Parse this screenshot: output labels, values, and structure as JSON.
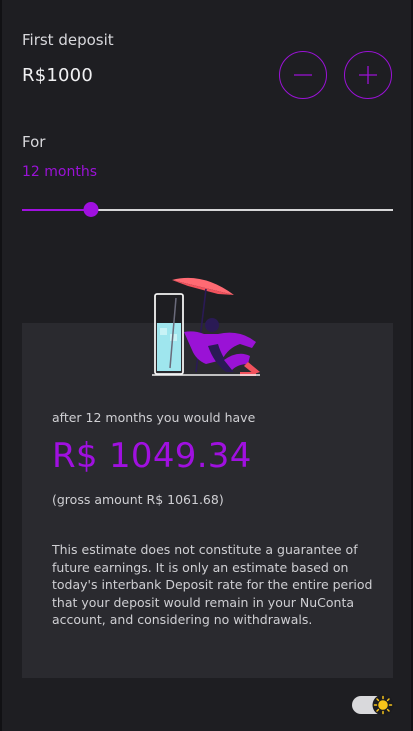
{
  "deposit": {
    "label": "First deposit",
    "amount": "R$1000",
    "decrease_icon": "minus-icon",
    "increase_icon": "plus-icon"
  },
  "period": {
    "label": "For",
    "value": "12 months",
    "slider_fraction": 0.186
  },
  "result": {
    "intro": "after 12 months you would have",
    "amount": "R$ 1049.34",
    "gross": "(gross amount R$ 1061.68)",
    "disclaimer": "This estimate does not constitute a guarantee of future earnings. It is only an estimate based on today's interbank Deposit rate for the entire period that your deposit would remain in your NuConta account, and considering no withdrawals."
  },
  "theme_toggle": {
    "icon": "sun-icon"
  },
  "colors": {
    "accent": "#a010e0",
    "background": "#1e1e22",
    "card": "#2a2a2f"
  }
}
